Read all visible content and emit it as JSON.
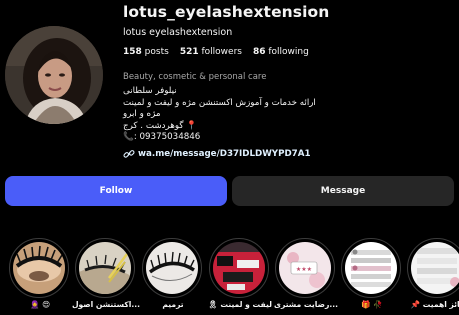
{
  "profile": {
    "username": "lotus_eyelashextension",
    "full_name": "lotus eyelashextension",
    "more_icon": "more-horizontal-icon",
    "avatar_icon": "profile-photo"
  },
  "stats": {
    "posts_count": "158",
    "posts_label": "posts",
    "followers_count": "521",
    "followers_label": "followers",
    "following_count": "86",
    "following_label": "following"
  },
  "bio": {
    "category": "Beauty, cosmetic & personal care",
    "lines": [
      "نیلوفر سلطانی",
      "ارائه خدمات و آموزش اکستنشن مژه و لیفت و لمینت",
      "مژه و ابرو",
      "📍 گوهردشت . کرج",
      "📞: 09375034846"
    ],
    "link_icon": "link-icon",
    "link_text": "wa.me/message/D37IDLDWYPD7A1"
  },
  "actions": {
    "follow_label": "Follow",
    "message_label": "Message"
  },
  "highlights": [
    {
      "label": "🧕 😍",
      "icon": "highlight-lashes"
    },
    {
      "label": "اکستنشن اصول...",
      "icon": "highlight-extension"
    },
    {
      "label": "ترمیم",
      "icon": "highlight-repair"
    },
    {
      "label": "🎗 لیفت و لمینت",
      "icon": "highlight-lift"
    },
    {
      "label": "رضایت مشتری...",
      "icon": "highlight-reviews"
    },
    {
      "label": "🎁 🥀",
      "icon": "highlight-gifts"
    },
    {
      "label": "📌 حائز اهمیت",
      "icon": "highlight-important"
    }
  ],
  "colors": {
    "background": "#000000",
    "follow_button": "#4a5df9",
    "message_button": "#262626",
    "link": "#e0f1ff",
    "muted_text": "#a8a8a8"
  }
}
